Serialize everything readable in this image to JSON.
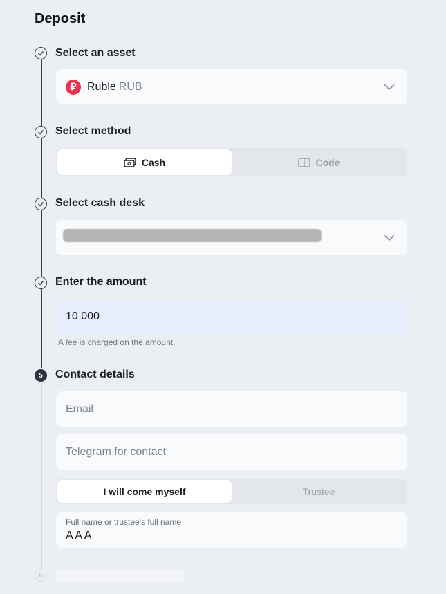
{
  "page": {
    "title": "Deposit"
  },
  "steps": [
    {
      "label": "Select an asset",
      "state": "done"
    },
    {
      "label": "Select method",
      "state": "done"
    },
    {
      "label": "Select cash desk",
      "state": "done"
    },
    {
      "label": "Enter the amount",
      "state": "done"
    },
    {
      "label": "Contact details",
      "state": "current",
      "number": "5"
    },
    {
      "label": "",
      "state": "upcoming",
      "number": "6"
    }
  ],
  "asset": {
    "icon": "ruble-coin-icon",
    "symbol": "₽",
    "name": "Ruble",
    "code": "RUB",
    "icon_color": "#e8334f"
  },
  "method": {
    "options": [
      {
        "label": "Cash",
        "icon": "cash-icon",
        "selected": true
      },
      {
        "label": "Code",
        "icon": "code-ticket-icon",
        "selected": false
      }
    ]
  },
  "cash_desk": {
    "value": "",
    "redacted": true
  },
  "amount": {
    "value": "10 000",
    "hint": "A fee is charged on the amount"
  },
  "contact": {
    "email_placeholder": "Email",
    "telegram_placeholder": "Telegram for contact",
    "pickup": {
      "options": [
        {
          "label": "I will come myself",
          "selected": true
        },
        {
          "label": "Trustee",
          "selected": false
        }
      ]
    },
    "full_name_label": "Full name or trustee's full name",
    "full_name_value": "A A A"
  },
  "colors": {
    "background": "#ebeef2",
    "card": "#f9fafb",
    "amount_field": "#e6edfb",
    "rail": "#3a3f4a",
    "accent_red": "#e8334f"
  }
}
